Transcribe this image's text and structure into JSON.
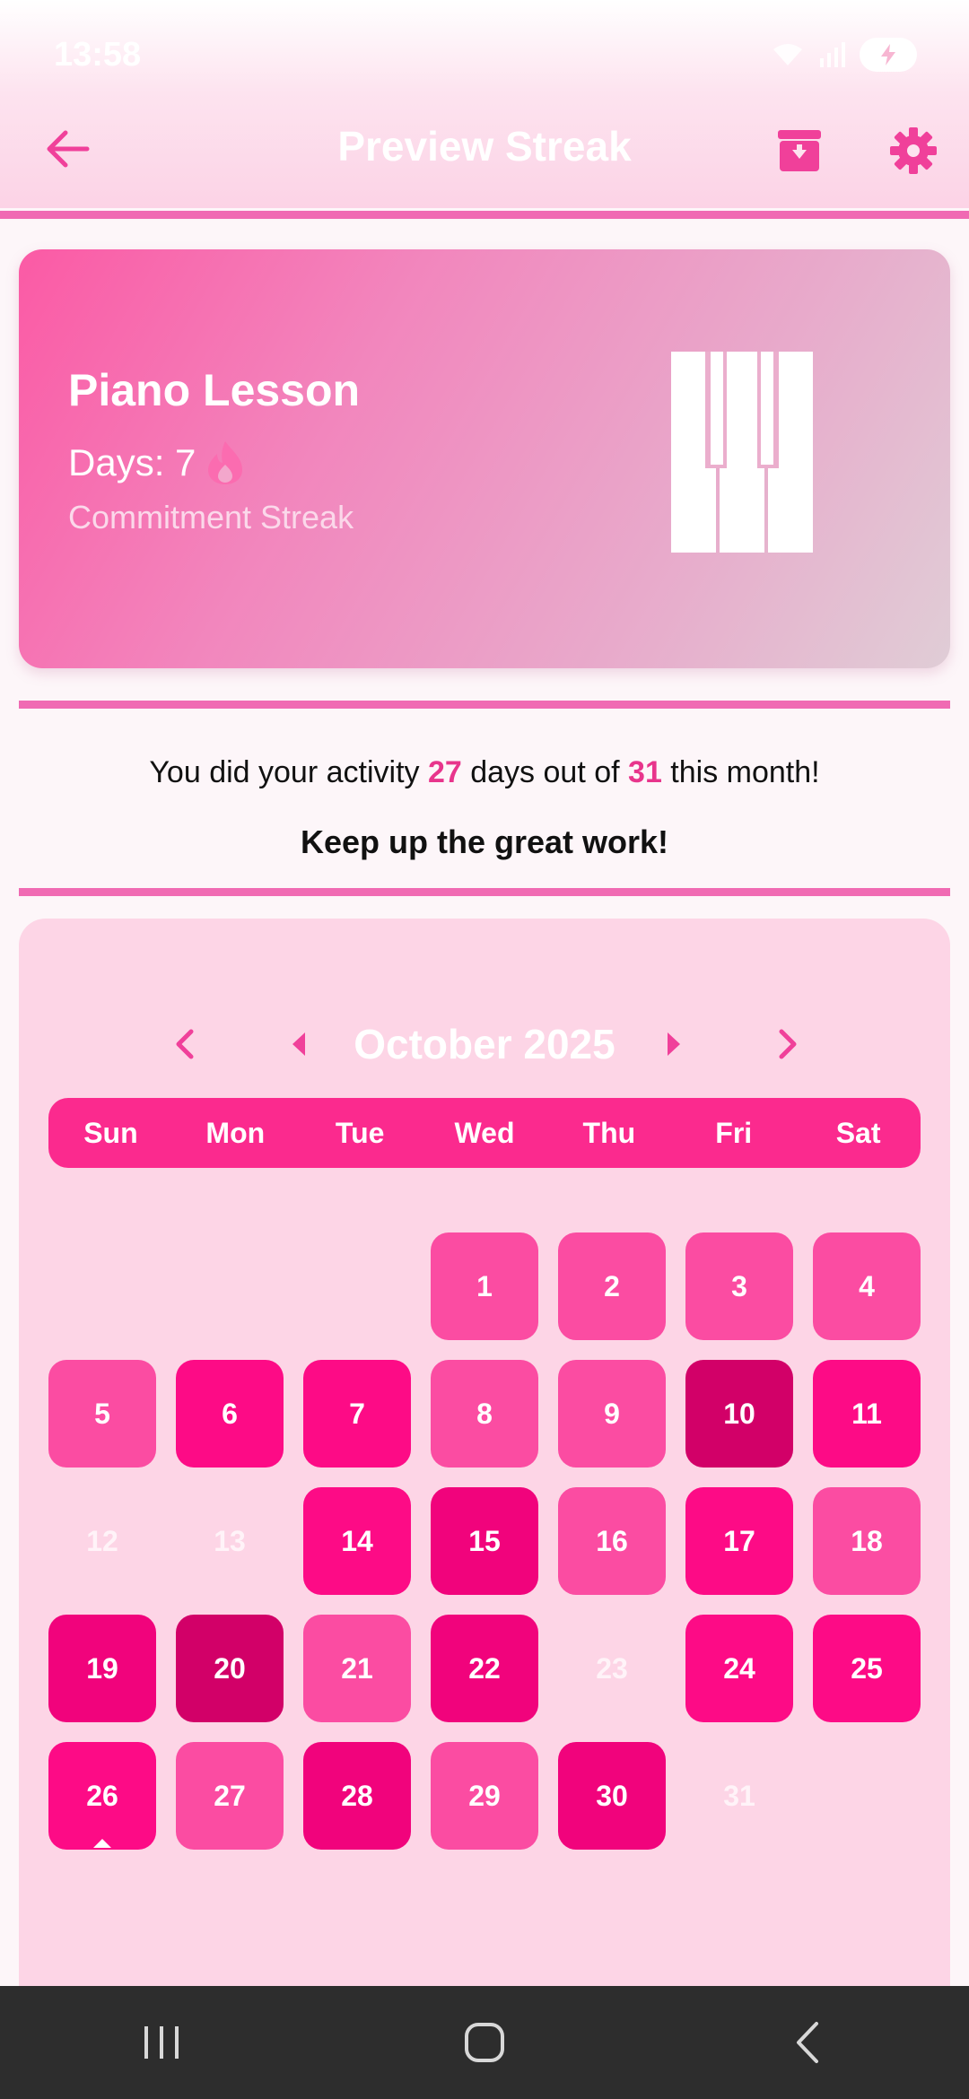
{
  "status_bar": {
    "time": "13:58"
  },
  "app_bar": {
    "title": "Preview Streak"
  },
  "streak_card": {
    "title": "Piano Lesson",
    "days_label": "Days: 7",
    "subtitle": "Commitment Streak"
  },
  "summary": {
    "prefix": "You did your activity ",
    "done": "27",
    "middle": " days out of ",
    "total": "31",
    "suffix": " this month!",
    "encouragement": "Keep up the great work!"
  },
  "calendar": {
    "month_label": "October 2025",
    "weekdays": [
      "Sun",
      "Mon",
      "Tue",
      "Wed",
      "Thu",
      "Fri",
      "Sat"
    ],
    "first_weekday_index": 3,
    "today": 26,
    "days": [
      {
        "n": "1",
        "color": "#fb4ca2"
      },
      {
        "n": "2",
        "color": "#fb4ca2"
      },
      {
        "n": "3",
        "color": "#fb4ca2"
      },
      {
        "n": "4",
        "color": "#fb4ca2"
      },
      {
        "n": "5",
        "color": "#fb4ca2"
      },
      {
        "n": "6",
        "color": "#fd0b86"
      },
      {
        "n": "7",
        "color": "#fd0b86"
      },
      {
        "n": "8",
        "color": "#fb4ca2"
      },
      {
        "n": "9",
        "color": "#fb4ca2"
      },
      {
        "n": "10",
        "color": "#d20068"
      },
      {
        "n": "11",
        "color": "#fd0b86"
      },
      {
        "n": "12",
        "color": null
      },
      {
        "n": "13",
        "color": null
      },
      {
        "n": "14",
        "color": "#fd0b86"
      },
      {
        "n": "15",
        "color": "#f1037c"
      },
      {
        "n": "16",
        "color": "#fb4ca2"
      },
      {
        "n": "17",
        "color": "#fd0b86"
      },
      {
        "n": "18",
        "color": "#fb4ca2"
      },
      {
        "n": "19",
        "color": "#f1037c"
      },
      {
        "n": "20",
        "color": "#d20068"
      },
      {
        "n": "21",
        "color": "#fb4ca2"
      },
      {
        "n": "22",
        "color": "#f1037c"
      },
      {
        "n": "23",
        "color": null
      },
      {
        "n": "24",
        "color": "#fd0b86"
      },
      {
        "n": "25",
        "color": "#fd0b86"
      },
      {
        "n": "26",
        "color": "#fd0b86"
      },
      {
        "n": "27",
        "color": "#fb4ca2"
      },
      {
        "n": "28",
        "color": "#f1037c"
      },
      {
        "n": "29",
        "color": "#fb4ca2"
      },
      {
        "n": "30",
        "color": "#f1037c"
      },
      {
        "n": "31",
        "color": null
      }
    ]
  },
  "colors": {
    "accent": "#f06ab3",
    "primary": "#fb2a8e",
    "calendar_bg": "#fdd5e6"
  },
  "icons": {
    "back": "arrow-left-icon",
    "archive": "archive-icon",
    "settings": "gear-icon",
    "streak": "flame-icon",
    "activity": "piano-icon"
  }
}
